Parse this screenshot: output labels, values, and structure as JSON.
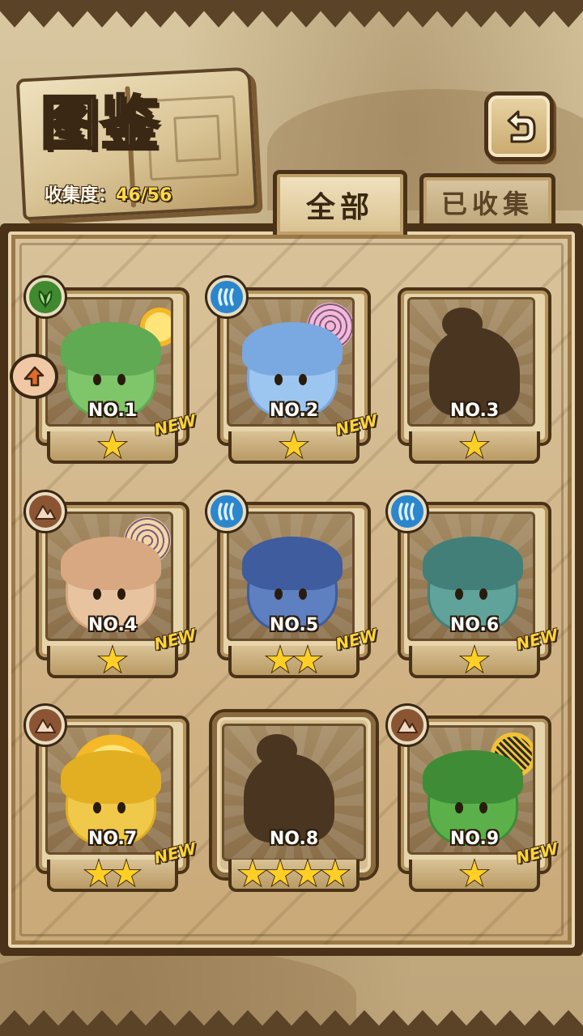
{
  "header": {
    "title": "图鉴",
    "collection_label": "收集度：",
    "collection_count": "46/56"
  },
  "tabs": [
    {
      "label": "全部",
      "active": true
    },
    {
      "label": "已收集",
      "active": false
    }
  ],
  "icons": {
    "back": "back-arrow-icon",
    "leaf": "leaf-element-icon",
    "water": "water-element-icon",
    "earth": "earth-element-icon",
    "favorite": "favorite-marker-icon",
    "star": "star-icon"
  },
  "colors": {
    "star": "#ffcf26",
    "new_badge": "#ffd43a",
    "leaf": "#3f8a2e",
    "water": "#2b86cc",
    "earth": "#8b5534"
  },
  "cards": [
    {
      "number": "NO.1",
      "element": "leaf",
      "stars": 1,
      "is_new": true,
      "new_label": "NEW",
      "collected": true,
      "favorite": true
    },
    {
      "number": "NO.2",
      "element": "water",
      "stars": 1,
      "is_new": true,
      "new_label": "NEW",
      "collected": true
    },
    {
      "number": "NO.3",
      "element": null,
      "stars": 1,
      "is_new": false,
      "collected": false
    },
    {
      "number": "NO.4",
      "element": "earth",
      "stars": 1,
      "is_new": true,
      "new_label": "NEW",
      "collected": true
    },
    {
      "number": "NO.5",
      "element": "water",
      "stars": 2,
      "is_new": true,
      "new_label": "NEW",
      "collected": true
    },
    {
      "number": "NO.6",
      "element": "water",
      "stars": 1,
      "is_new": true,
      "new_label": "NEW",
      "collected": true
    },
    {
      "number": "NO.7",
      "element": "earth",
      "stars": 2,
      "is_new": true,
      "new_label": "NEW",
      "collected": true
    },
    {
      "number": "NO.8",
      "element": null,
      "stars": 4,
      "is_new": false,
      "collected": false
    },
    {
      "number": "NO.9",
      "element": "earth",
      "stars": 1,
      "is_new": true,
      "new_label": "NEW",
      "collected": true
    }
  ]
}
